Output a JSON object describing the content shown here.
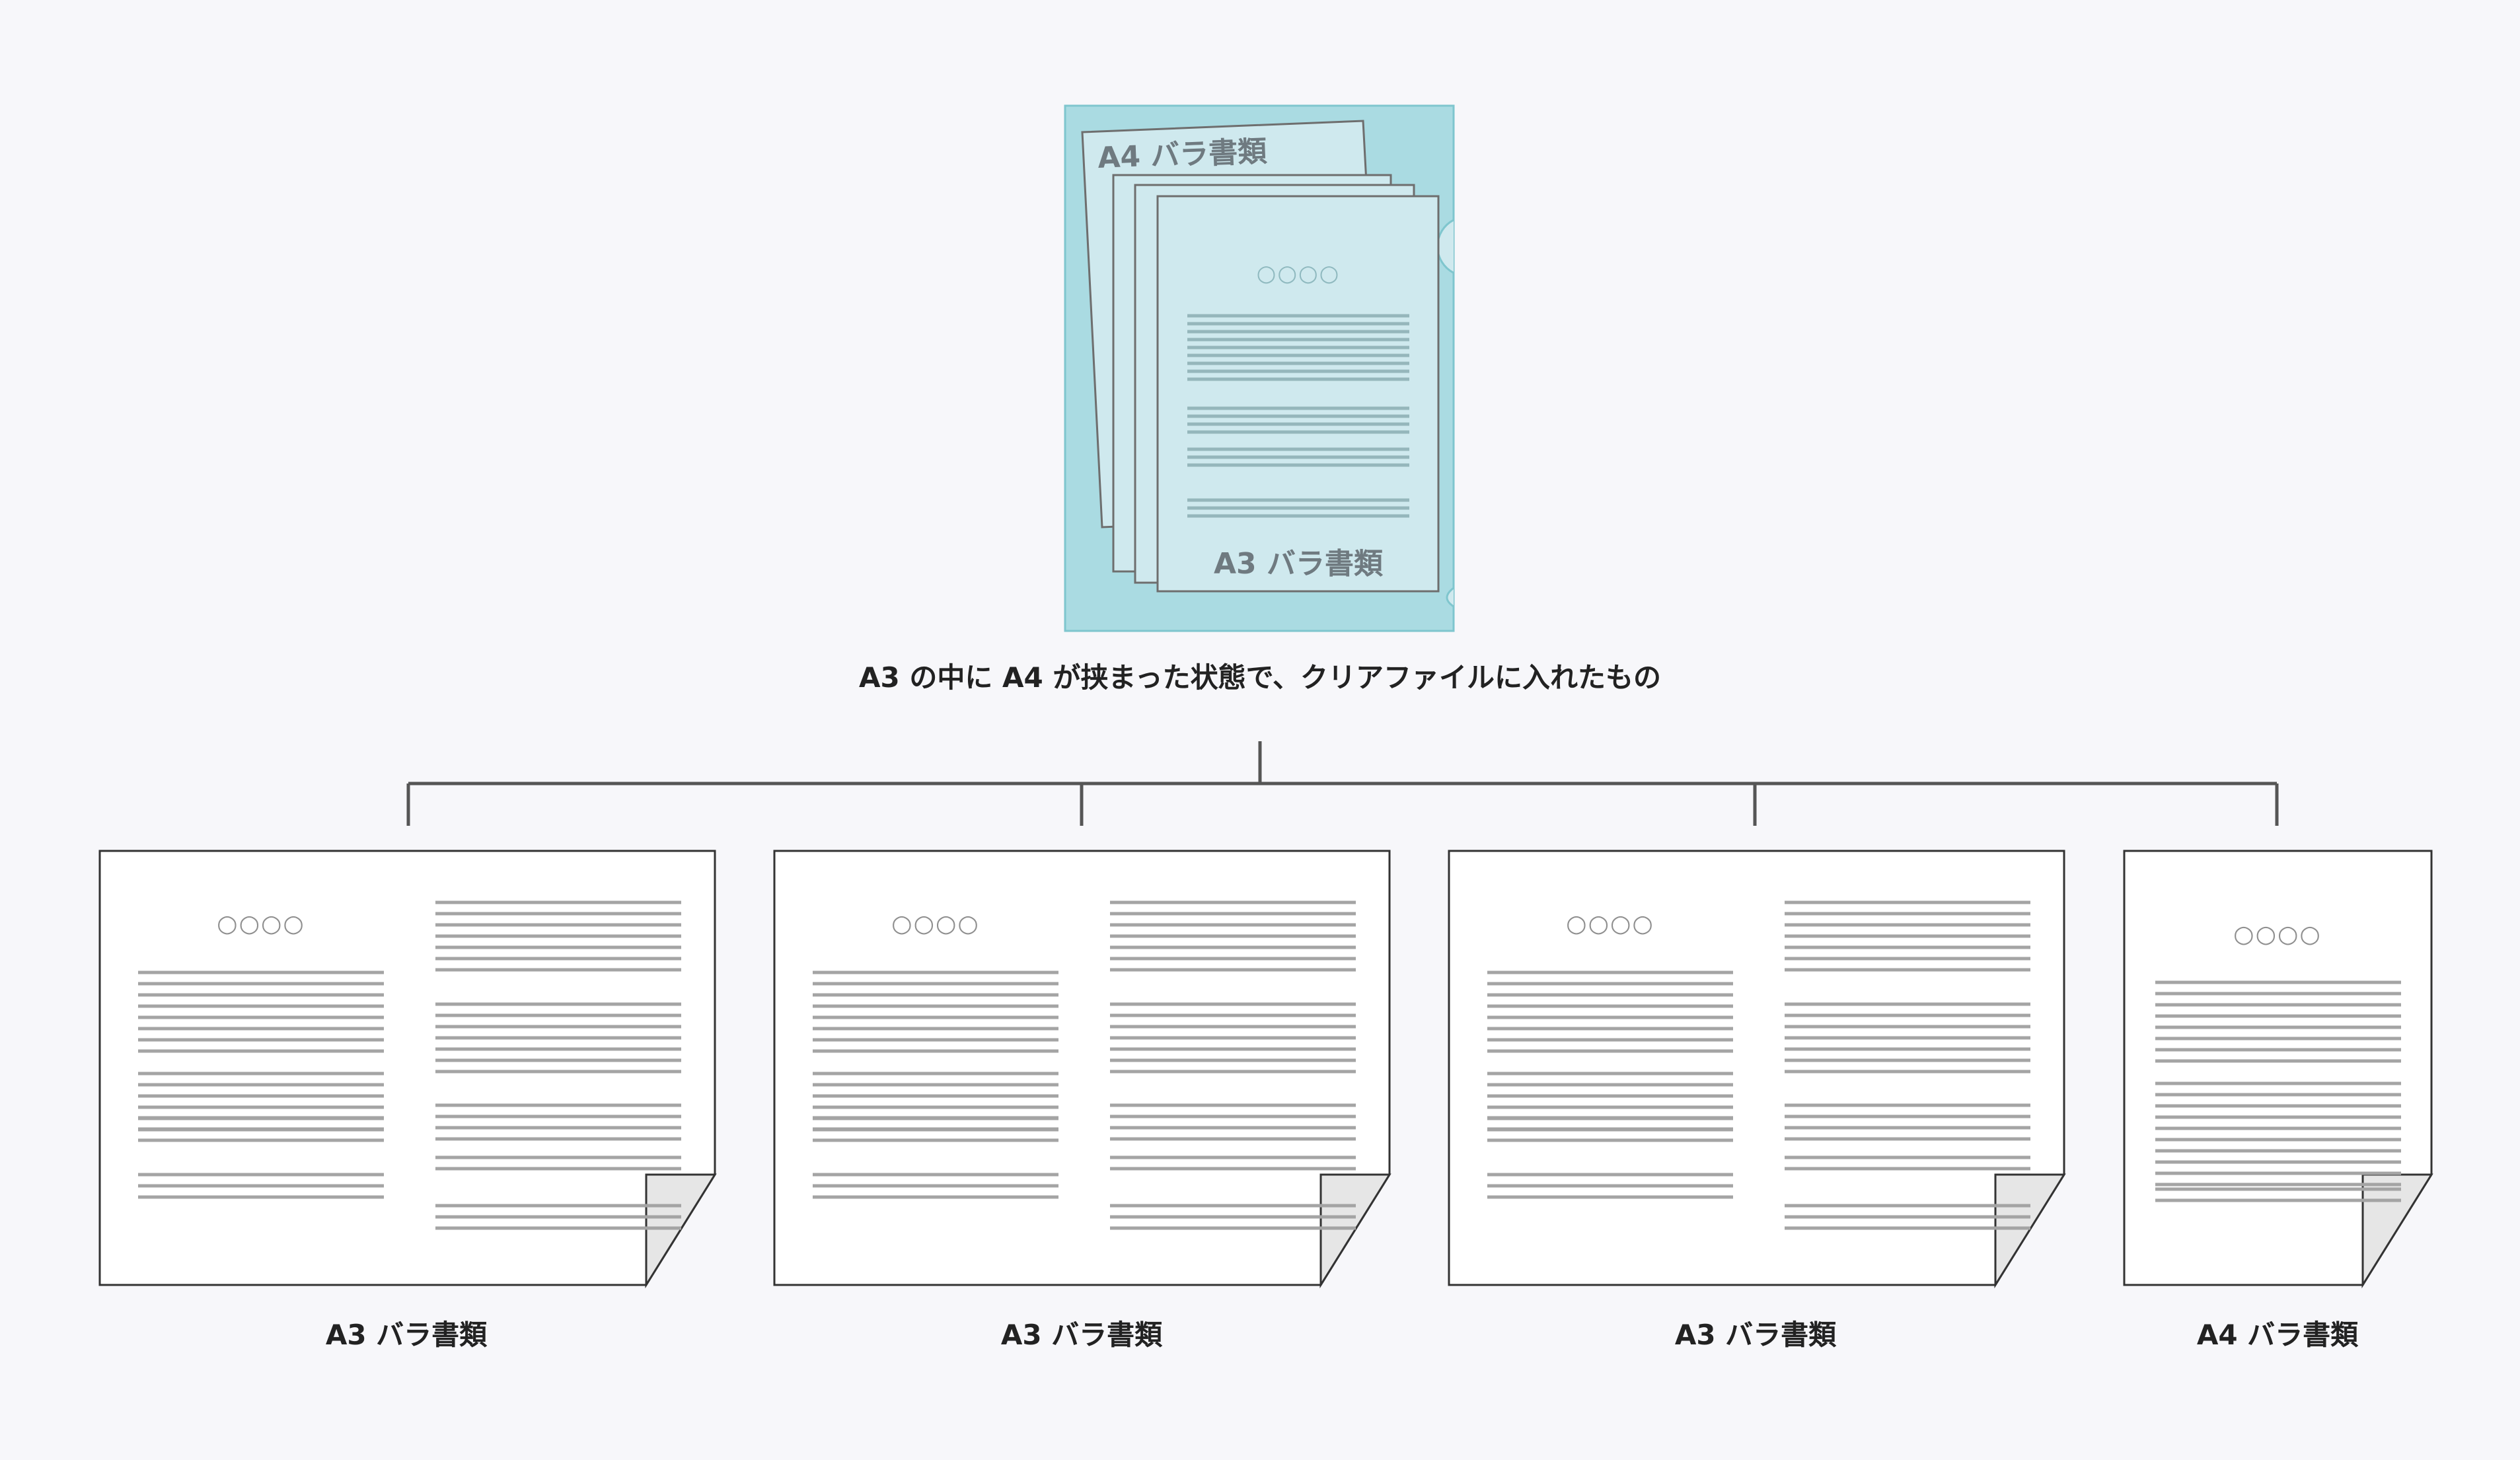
{
  "colors": {
    "background": "#f7f7fa",
    "folder_fill": "#aadbe2",
    "folder_stroke": "#7fc6ce",
    "inner_sheet_fill": "#cfe9ee",
    "sheet_stroke": "#6e6e6e",
    "text_lines": "#a4a4a4",
    "connector": "#555555",
    "page_fill": "#ffffff",
    "page_fold": "#e6e6e6"
  },
  "folder": {
    "back_sheet_label": "A4 バラ書類",
    "front_sheet_label": "A3 バラ書類",
    "front_sheet_circles": "○○○○"
  },
  "caption": "A3 の中に A4 が挟まった状態で、クリアファイルに入れたもの",
  "documents": [
    {
      "label": "A3 バラ書類",
      "size": "A3",
      "circles": "○○○○"
    },
    {
      "label": "A3 バラ書類",
      "size": "A3",
      "circles": "○○○○"
    },
    {
      "label": "A3 バラ書類",
      "size": "A3",
      "circles": "○○○○"
    },
    {
      "label": "A4 バラ書類",
      "size": "A4",
      "circles": "○○○○"
    }
  ]
}
